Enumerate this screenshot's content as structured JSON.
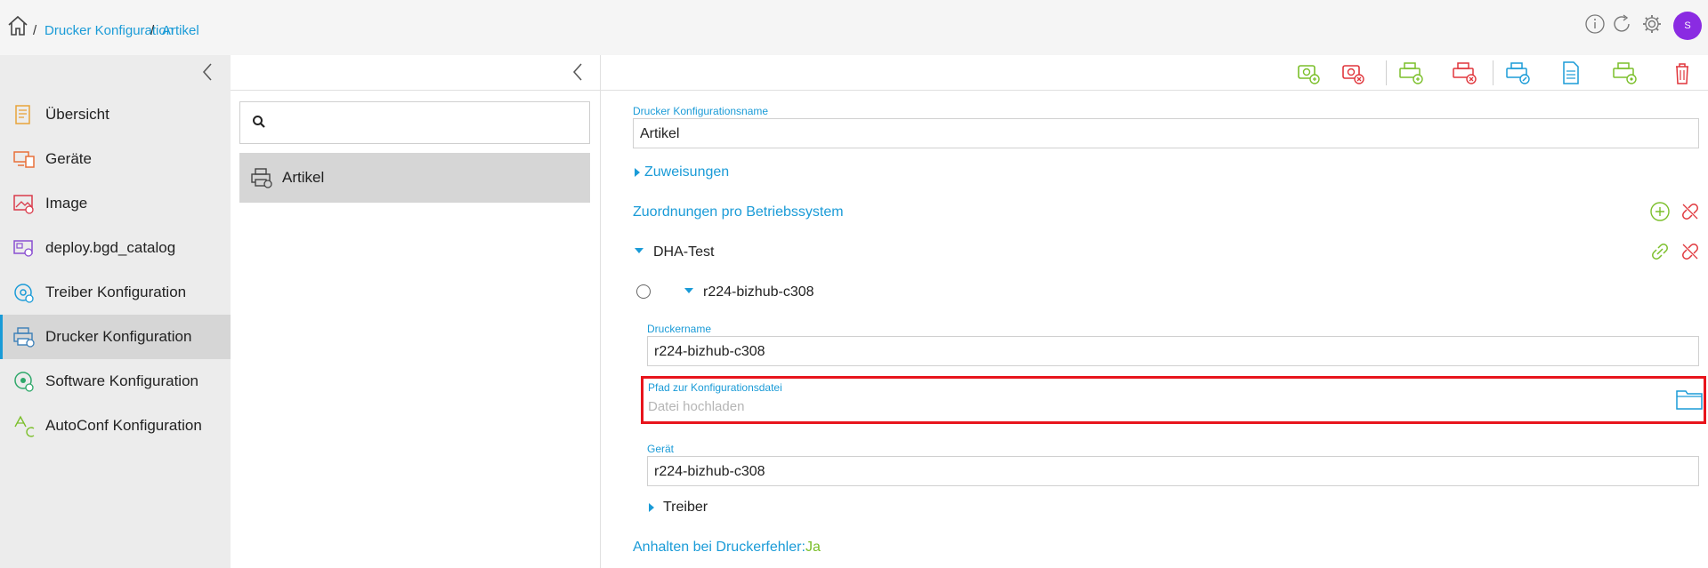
{
  "breadcrumb": {
    "separator": "/",
    "items": [
      "Drucker Konfiguration",
      "Artikel"
    ]
  },
  "user": {
    "initial": "S"
  },
  "colors": {
    "accent": "#1a9bd7",
    "green": "#7bbf2a",
    "red": "#e0353b",
    "highlight": "#e8141c",
    "avatar": "#8a2be2"
  },
  "sidebar": {
    "items": [
      {
        "label": "Übersicht",
        "icon": "overview-icon"
      },
      {
        "label": "Geräte",
        "icon": "devices-icon"
      },
      {
        "label": "Image",
        "icon": "image-icon"
      },
      {
        "label": "deploy.bgd_catalog",
        "icon": "catalog-icon"
      },
      {
        "label": "Treiber Konfiguration",
        "icon": "driver-config-icon"
      },
      {
        "label": "Drucker Konfiguration",
        "icon": "printer-config-icon",
        "active": true
      },
      {
        "label": "Software Konfiguration",
        "icon": "software-config-icon"
      },
      {
        "label": "AutoConf Konfiguration",
        "icon": "autoconf-config-icon"
      }
    ]
  },
  "list": {
    "search_placeholder": "",
    "items": [
      {
        "label": "Artikel",
        "selected": true
      }
    ]
  },
  "detail": {
    "name_label": "Drucker Konfigurationsname",
    "name_value": "Artikel",
    "zuweisungen": "Zuweisungen",
    "os_section": "Zuordnungen pro Betriebssystem",
    "group_name": "DHA-Test",
    "printer_node": "r224-bizhub-c308",
    "printer_name_label": "Druckername",
    "printer_name_value": "r224-bizhub-c308",
    "config_path_label": "Pfad zur Konfigurationsdatei",
    "config_path_placeholder": "Datei hochladen",
    "device_label": "Gerät",
    "device_value": "r224-bizhub-c308",
    "driver_section": "Treiber",
    "halt_label": "Anhalten bei Druckerfehler:",
    "halt_value": "Ja"
  }
}
